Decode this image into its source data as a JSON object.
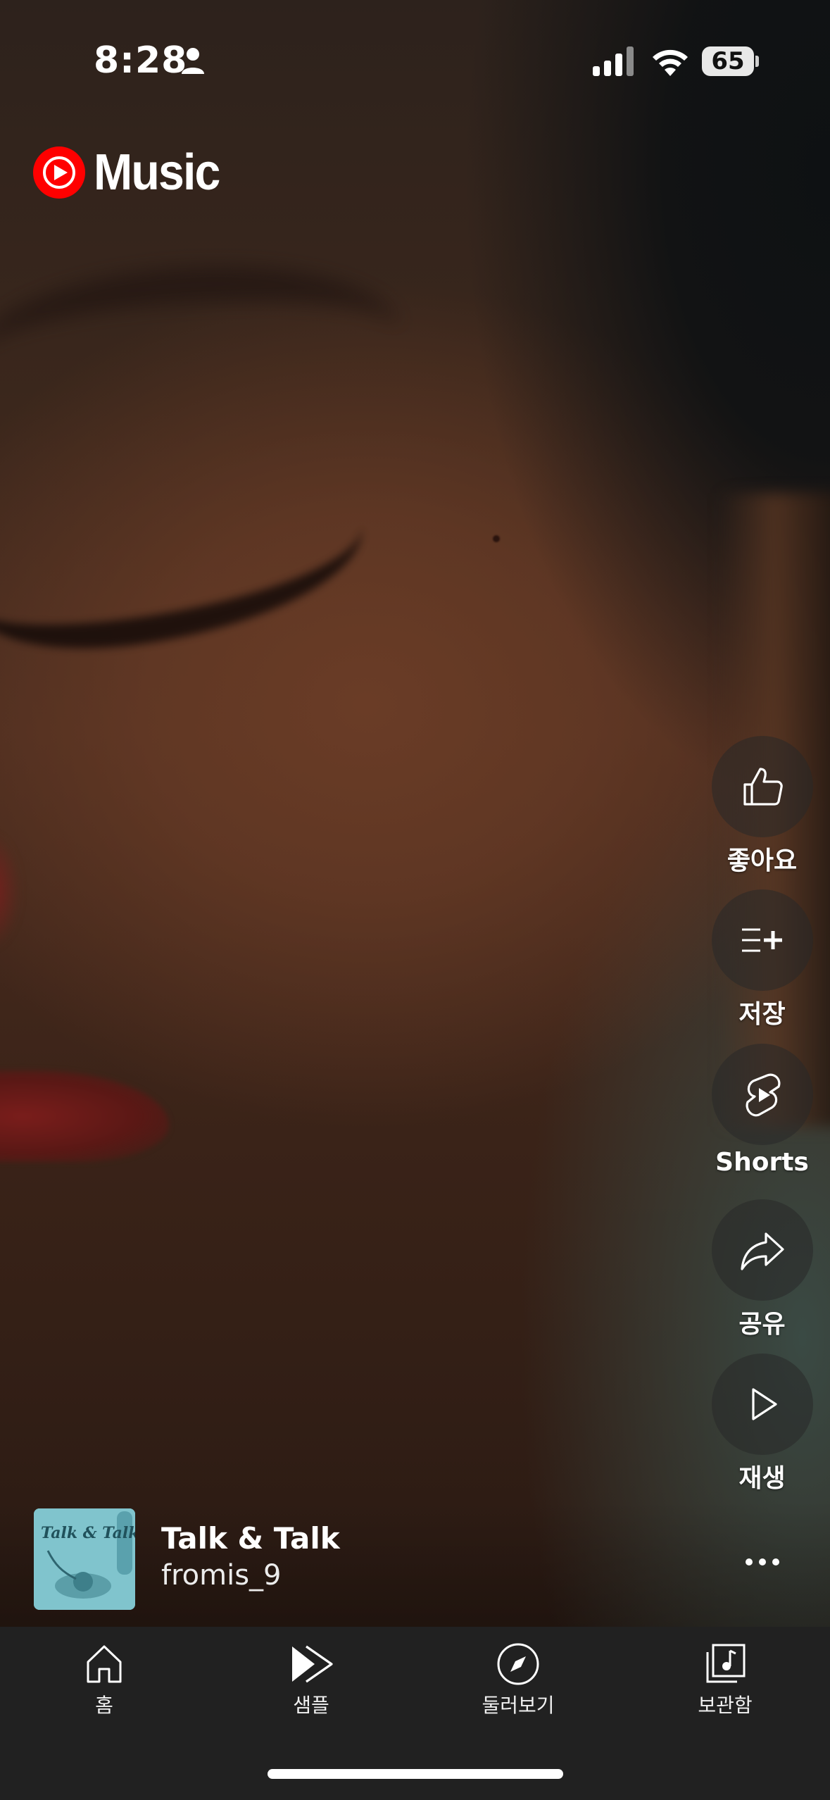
{
  "status_bar": {
    "time": "8:28",
    "battery": "65",
    "icons": [
      "person-icon",
      "signal-icon",
      "wifi-icon",
      "battery-icon"
    ]
  },
  "app": {
    "logo_text": "Music",
    "accent_color": "#ff0000"
  },
  "actions": [
    {
      "label": "좋아요",
      "icon": "thumbs-up-icon"
    },
    {
      "label": "저장",
      "icon": "playlist-add-icon"
    },
    {
      "label": "Shorts",
      "icon": "shorts-icon"
    },
    {
      "label": "공유",
      "icon": "share-icon"
    },
    {
      "label": "재생",
      "icon": "play-icon"
    }
  ],
  "now_playing": {
    "title": "Talk & Talk",
    "artist": "fromis_9",
    "album_art_text": "Talk & Talk",
    "more_icon": "more-horizontal-icon"
  },
  "bottom_nav": [
    {
      "label": "홈",
      "icon": "home-icon"
    },
    {
      "label": "샘플",
      "icon": "samples-icon"
    },
    {
      "label": "둘러보기",
      "icon": "explore-icon"
    },
    {
      "label": "보관함",
      "icon": "library-icon"
    }
  ]
}
